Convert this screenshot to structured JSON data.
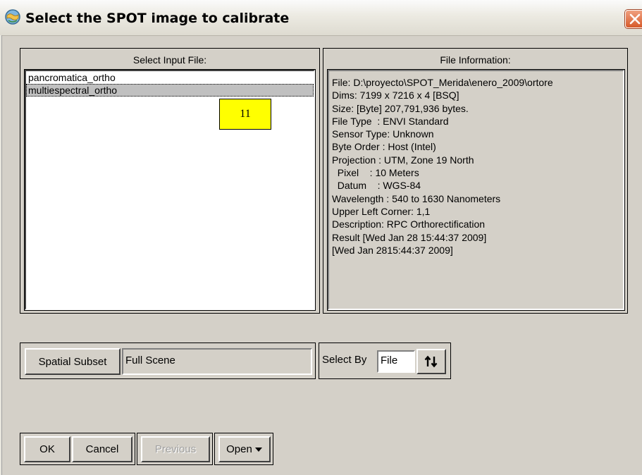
{
  "window": {
    "title": "Select the SPOT image to calibrate"
  },
  "input_panel": {
    "label": "Select Input File:",
    "files": [
      "pancromatica_ortho",
      "multiespectral_ortho"
    ],
    "selected_index": 1
  },
  "annotation": {
    "number": "11",
    "color": "#ffff00"
  },
  "info_panel": {
    "label": "File Information:",
    "lines": [
      "File: D:\\proyecto\\SPOT_Merida\\enero_2009\\ortore",
      "Dims: 7199 x 7216 x 4 [BSQ]",
      "Size: [Byte] 207,791,936 bytes.",
      "File Type  : ENVI Standard",
      "Sensor Type: Unknown",
      "Byte Order : Host (Intel)",
      "Projection : UTM, Zone 19 North",
      "  Pixel    : 10 Meters",
      "  Datum    : WGS-84",
      "Wavelength : 540 to 1630 Nanometers",
      "Upper Left Corner: 1,1",
      "Description: RPC Orthorectification",
      "Result [Wed Jan 28 15:44:37 2009]",
      "[Wed Jan 2815:44:37 2009]"
    ]
  },
  "subset": {
    "button_label": "Spatial Subset",
    "value": "Full Scene"
  },
  "select_by": {
    "label": "Select By",
    "value": "File",
    "icon": "sort-arrows-icon"
  },
  "buttons": {
    "ok": "OK",
    "cancel": "Cancel",
    "previous": "Previous",
    "open": "Open"
  }
}
